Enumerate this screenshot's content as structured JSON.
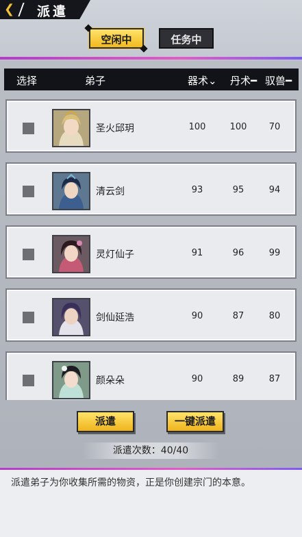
{
  "header": {
    "title": "派遣",
    "back_icon": "chevron-left-icon"
  },
  "tabs": [
    {
      "label": "空闲中",
      "active": true
    },
    {
      "label": "任务中",
      "active": false
    }
  ],
  "table": {
    "columns": [
      "选择",
      "弟子",
      "器术⌄",
      "丹术━",
      "驭兽━"
    ],
    "rows": [
      {
        "name": "圣火邱玥",
        "weapon": "100",
        "alchemy": "100",
        "beast": "70",
        "checked": false
      },
      {
        "name": "清云剑",
        "weapon": "93",
        "alchemy": "95",
        "beast": "94",
        "checked": false
      },
      {
        "name": "灵灯仙子",
        "weapon": "91",
        "alchemy": "96",
        "beast": "99",
        "checked": false
      },
      {
        "name": "剑仙延浩",
        "weapon": "90",
        "alchemy": "87",
        "beast": "80",
        "checked": false
      },
      {
        "name": "颜朵朵",
        "weapon": "90",
        "alchemy": "89",
        "beast": "87",
        "checked": false
      }
    ]
  },
  "actions": {
    "dispatch_label": "派遣",
    "one_key_label": "一键派遣"
  },
  "dispatch_count": {
    "label": "派遣次数：40/40"
  },
  "description": "派遣弟子为你收集所需的物资，正是你创建宗门的本意。",
  "colors": {
    "accent_yellow": "#f1c232",
    "header_dark": "#111318",
    "pink_line": "#e45ac7"
  }
}
